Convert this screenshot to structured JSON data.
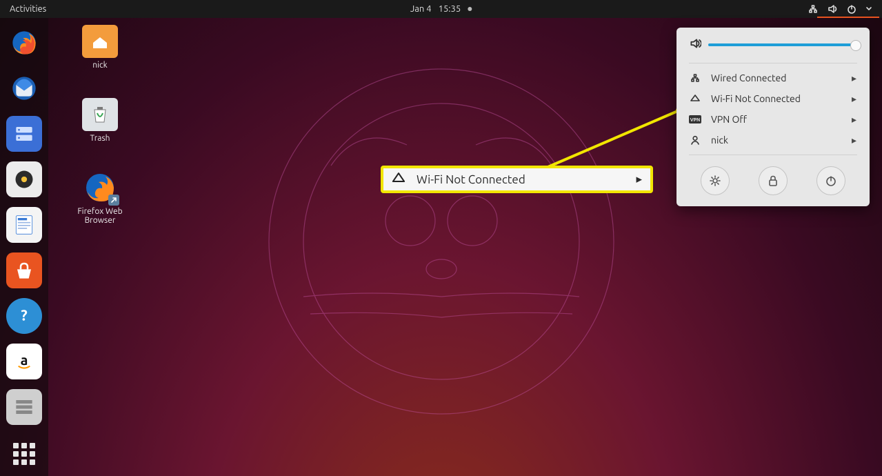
{
  "topbar": {
    "activities": "Activities",
    "date": "Jan 4",
    "time": "15:35"
  },
  "desktop_icons": {
    "home": "nick",
    "trash": "Trash",
    "firefox": "Firefox Web Browser"
  },
  "system_menu": {
    "volume_pct": 100,
    "items": [
      {
        "label": "Wired Connected"
      },
      {
        "label": "Wi-Fi Not Connected"
      },
      {
        "label": "VPN Off"
      },
      {
        "label": "nick"
      }
    ]
  },
  "callout": {
    "label": "Wi-Fi Not Connected"
  },
  "colors": {
    "accent": "#e95420",
    "slider": "#1e9ed8",
    "highlight": "#f2e600"
  }
}
